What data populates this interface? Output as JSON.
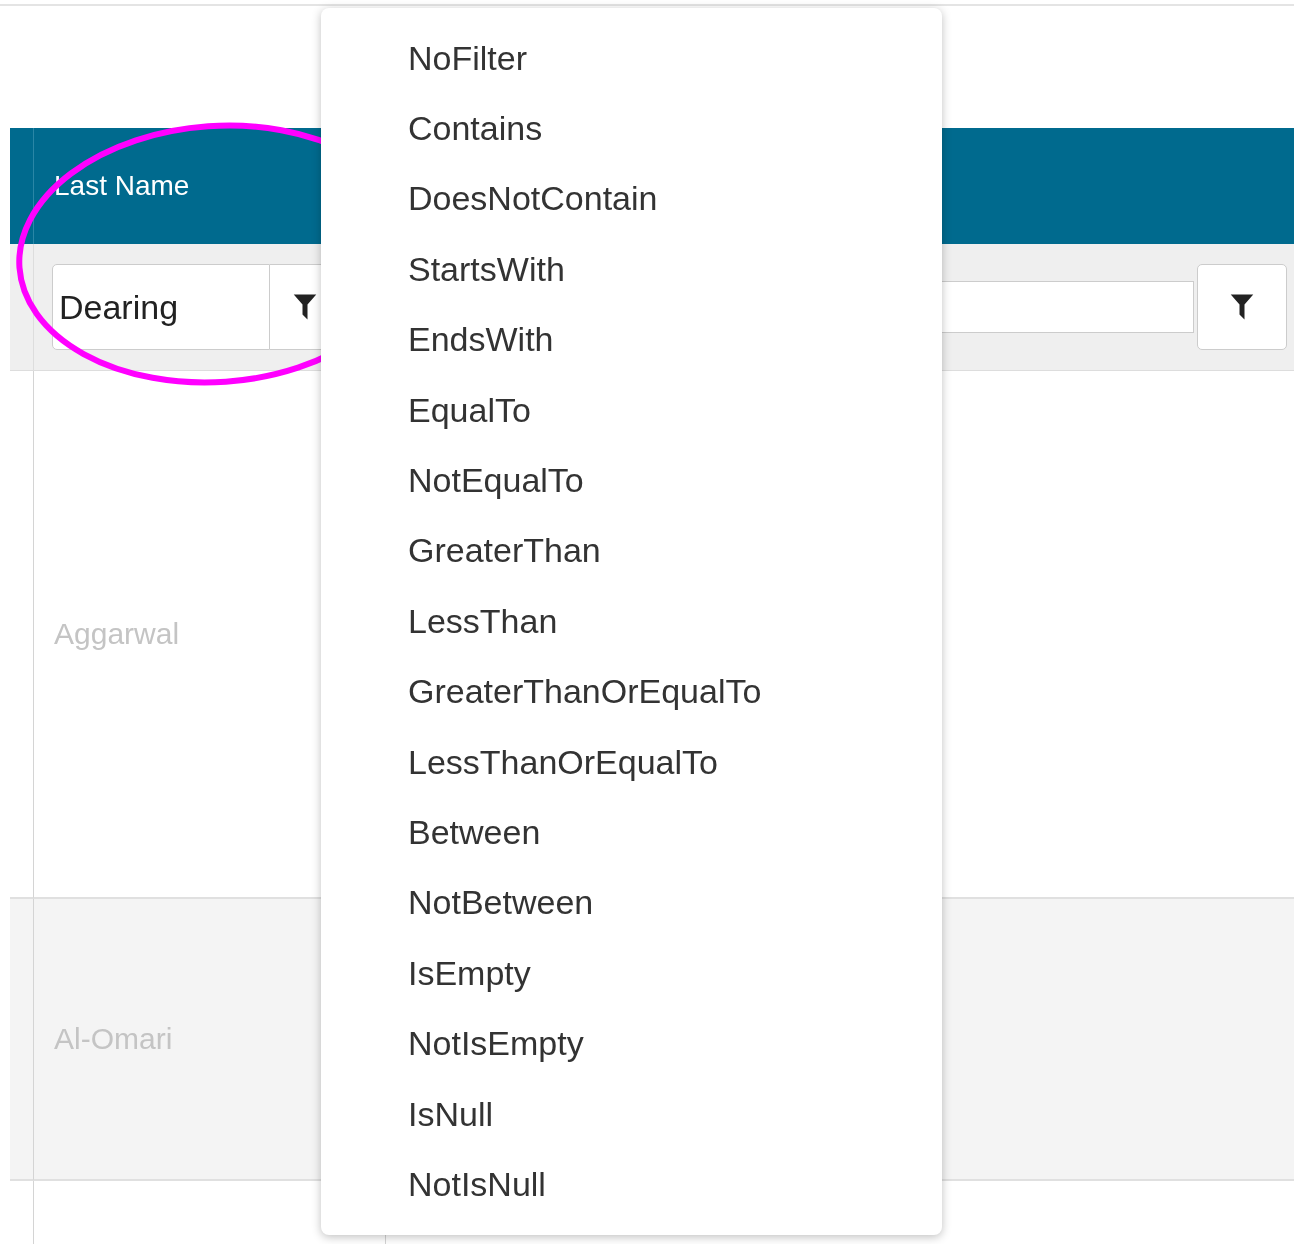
{
  "grid": {
    "columns": [
      {
        "header": "Last Name",
        "filter_value": "Dearing"
      },
      {}
    ],
    "rows": [
      {
        "last_name": "Aggarwal",
        "faded": true
      },
      {
        "last_name": "Al-Omari",
        "faded": true
      }
    ]
  },
  "filter_menu": {
    "items": [
      {
        "label": "NoFilter",
        "selected": false
      },
      {
        "label": "Contains",
        "selected": false
      },
      {
        "label": "DoesNotContain",
        "selected": false
      },
      {
        "label": "StartsWith",
        "selected": false
      },
      {
        "label": "EndsWith",
        "selected": false
      },
      {
        "label": "EqualTo",
        "selected": false
      },
      {
        "label": "NotEqualTo",
        "selected": false
      },
      {
        "label": "GreaterThan",
        "selected": false
      },
      {
        "label": "LessThan",
        "selected": false
      },
      {
        "label": "GreaterThanOrEqualTo",
        "selected": false
      },
      {
        "label": "LessThanOrEqualTo",
        "selected": false
      },
      {
        "label": "Between",
        "selected": false
      },
      {
        "label": "NotBetween",
        "selected": false
      },
      {
        "label": "IsEmpty",
        "selected": false
      },
      {
        "label": "NotIsEmpty",
        "selected": false
      },
      {
        "label": "IsNull",
        "selected": false
      },
      {
        "label": "NotIsNull",
        "selected": false
      }
    ]
  },
  "annotation": {
    "kind": "ellipse"
  }
}
